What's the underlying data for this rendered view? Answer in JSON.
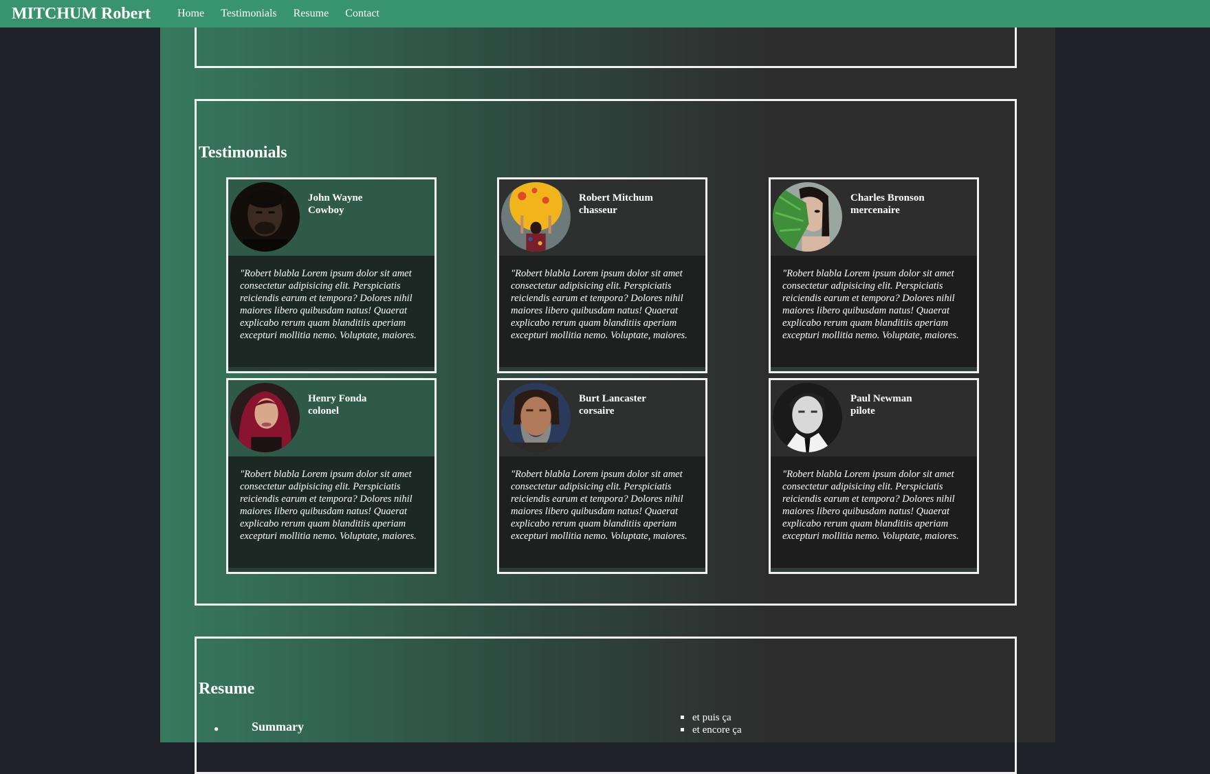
{
  "navbar": {
    "brand": "MITCHUM Robert",
    "links": [
      "Home",
      "Testimonials",
      "Resume",
      "Contact"
    ]
  },
  "testimonials": {
    "title": "Testimonials",
    "cards": [
      {
        "name": "John Wayne",
        "role": "Cowboy",
        "quote": "\"Robert blabla Lorem ipsum dolor sit amet consectetur adipisicing elit. Perspiciatis reiciendis earum et tempora? Dolores nihil maiores libero quibusdam natus! Quaerat explicabo rerum quam blanditiis aperiam excepturi mollitia nemo. Voluptate, maiores."
      },
      {
        "name": "Robert Mitchum",
        "role": "chasseur",
        "quote": "\"Robert blabla Lorem ipsum dolor sit amet consectetur adipisicing elit. Perspiciatis reiciendis earum et tempora? Dolores nihil maiores libero quibusdam natus! Quaerat explicabo rerum quam blanditiis aperiam excepturi mollitia nemo. Voluptate, maiores."
      },
      {
        "name": "Charles Bronson",
        "role": "mercenaire",
        "quote": "\"Robert blabla Lorem ipsum dolor sit amet consectetur adipisicing elit. Perspiciatis reiciendis earum et tempora? Dolores nihil maiores libero quibusdam natus! Quaerat explicabo rerum quam blanditiis aperiam excepturi mollitia nemo. Voluptate, maiores."
      },
      {
        "name": "Henry Fonda",
        "role": "colonel",
        "quote": "\"Robert blabla Lorem ipsum dolor sit amet consectetur adipisicing elit. Perspiciatis reiciendis earum et tempora? Dolores nihil maiores libero quibusdam natus! Quaerat explicabo rerum quam blanditiis aperiam excepturi mollitia nemo. Voluptate, maiores."
      },
      {
        "name": "Burt Lancaster",
        "role": "corsaire",
        "quote": "\"Robert blabla Lorem ipsum dolor sit amet consectetur adipisicing elit. Perspiciatis reiciendis earum et tempora? Dolores nihil maiores libero quibusdam natus! Quaerat explicabo rerum quam blanditiis aperiam excepturi mollitia nemo. Voluptate, maiores."
      },
      {
        "name": "Paul Newman",
        "role": "pilote",
        "quote": "\"Robert blabla Lorem ipsum dolor sit amet consectetur adipisicing elit. Perspiciatis reiciendis earum et tempora? Dolores nihil maiores libero quibusdam natus! Quaerat explicabo rerum quam blanditiis aperiam excepturi mollitia nemo. Voluptate, maiores."
      }
    ]
  },
  "resume": {
    "title": "Resume",
    "summary_label": "Summary",
    "sub_items": [
      "et puis ça",
      "et encore ça"
    ]
  }
}
